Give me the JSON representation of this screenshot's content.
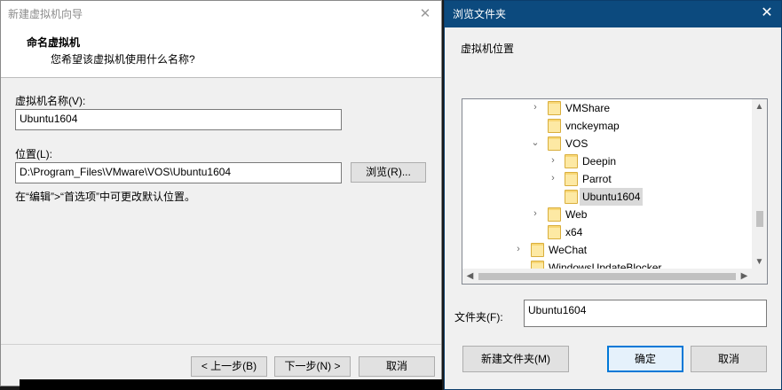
{
  "wizard": {
    "window_title": "新建虚拟机向导",
    "close_glyph": "✕",
    "heading": "命名虚拟机",
    "subheading": "您希望该虚拟机使用什么名称?",
    "name_label": "虚拟机名称(V):",
    "name_value": "Ubuntu1604",
    "location_label": "位置(L):",
    "location_value": "D:\\Program_Files\\VMware\\VOS\\Ubuntu1604",
    "browse_button": "浏览(R)...",
    "hint": "在“编辑”>“首选项”中可更改默认位置。",
    "back_button": "< 上一步(B)",
    "next_button": "下一步(N) >",
    "cancel_button": "取消"
  },
  "browse_dialog": {
    "title": "浏览文件夹",
    "close_glyph": "✕",
    "description": "虚拟机位置",
    "tree": [
      {
        "label": "VMShare",
        "expander": "›",
        "selected": false
      },
      {
        "label": "vnckeymap",
        "expander": "",
        "selected": false
      },
      {
        "label": "VOS",
        "expander": "⌄",
        "selected": false
      },
      {
        "label": "Deepin",
        "expander": "›",
        "selected": false
      },
      {
        "label": "Parrot",
        "expander": "›",
        "selected": false
      },
      {
        "label": "Ubuntu1604",
        "expander": "",
        "selected": true
      },
      {
        "label": "Web",
        "expander": "›",
        "selected": false
      },
      {
        "label": "x64",
        "expander": "",
        "selected": false
      },
      {
        "label": "WeChat",
        "expander": "›",
        "selected": false
      },
      {
        "label": "WindowsUpdateBlocker",
        "expander": "",
        "selected": false
      }
    ],
    "scroll_up": "▲",
    "scroll_down": "▼",
    "scroll_left": "◀",
    "scroll_right": "▶",
    "folder_label": "文件夹(F):",
    "folder_value": "Ubuntu1604",
    "new_folder_button": "新建文件夹(M)",
    "ok_button": "确定",
    "cancel_button": "取消"
  },
  "colors": {
    "dialog_titlebar": "#0c4a7e",
    "folder_icon": "#f8d775",
    "focus_border": "#0078d7",
    "selected_row": "#d9d9d9"
  }
}
